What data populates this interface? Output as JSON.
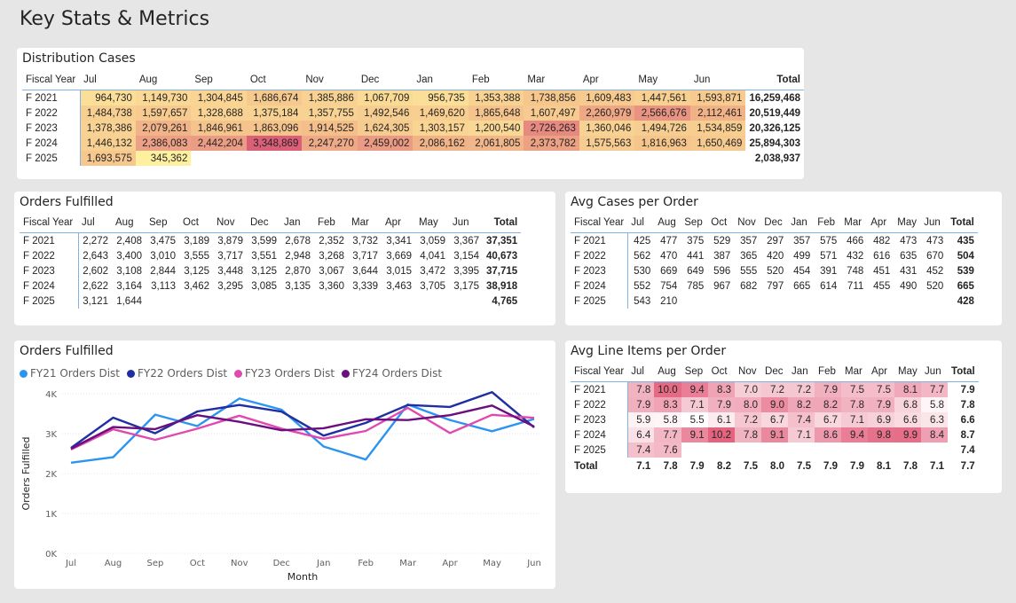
{
  "page": {
    "title": "Key Stats & Metrics"
  },
  "months": [
    "Jul",
    "Aug",
    "Sep",
    "Oct",
    "Nov",
    "Dec",
    "Jan",
    "Feb",
    "Mar",
    "Apr",
    "May",
    "Jun"
  ],
  "dist": {
    "title": "Distribution Cases",
    "fy_label": "Fiscal Year",
    "total_label": "Total",
    "rows": [
      {
        "fy": "F 2021",
        "vals": [
          "964,730",
          "1,149,730",
          "1,304,845",
          "1,686,674",
          "1,385,886",
          "1,067,709",
          "956,735",
          "1,353,388",
          "1,738,856",
          "1,609,483",
          "1,447,561",
          "1,593,871"
        ],
        "total": "16,259,468"
      },
      {
        "fy": "F 2022",
        "vals": [
          "1,484,738",
          "1,597,657",
          "1,328,688",
          "1,375,184",
          "1,357,755",
          "1,492,546",
          "1,469,620",
          "1,865,648",
          "1,607,497",
          "2,260,979",
          "2,566,676",
          "2,112,461"
        ],
        "total": "20,519,449"
      },
      {
        "fy": "F 2023",
        "vals": [
          "1,378,386",
          "2,079,261",
          "1,846,961",
          "1,863,096",
          "1,914,525",
          "1,624,305",
          "1,303,157",
          "1,200,540",
          "2,726,263",
          "1,360,046",
          "1,494,726",
          "1,534,859"
        ],
        "total": "20,326,125"
      },
      {
        "fy": "F 2024",
        "vals": [
          "1,446,132",
          "2,386,083",
          "2,442,204",
          "3,348,869",
          "2,247,270",
          "2,459,002",
          "2,086,162",
          "2,061,805",
          "2,373,782",
          "1,575,563",
          "1,816,963",
          "1,650,469"
        ],
        "total": "25,894,303"
      },
      {
        "fy": "F 2025",
        "vals": [
          "1,693,575",
          "345,362",
          "",
          "",
          "",
          "",
          "",
          "",
          "",
          "",
          "",
          ""
        ],
        "total": "2,038,937"
      }
    ]
  },
  "orders": {
    "title": "Orders Fulfilled",
    "fy_label": "Fiscal Year",
    "total_label": "Total",
    "rows": [
      {
        "fy": "F 2021",
        "vals": [
          "2,272",
          "2,408",
          "3,475",
          "3,189",
          "3,879",
          "3,599",
          "2,678",
          "2,352",
          "3,732",
          "3,341",
          "3,059",
          "3,367"
        ],
        "total": "37,351"
      },
      {
        "fy": "F 2022",
        "vals": [
          "2,643",
          "3,400",
          "3,010",
          "3,555",
          "3,717",
          "3,551",
          "2,948",
          "3,268",
          "3,717",
          "3,669",
          "4,041",
          "3,154"
        ],
        "total": "40,673"
      },
      {
        "fy": "F 2023",
        "vals": [
          "2,602",
          "3,108",
          "2,844",
          "3,125",
          "3,448",
          "3,125",
          "2,870",
          "3,067",
          "3,644",
          "3,015",
          "3,472",
          "3,395"
        ],
        "total": "37,715"
      },
      {
        "fy": "F 2024",
        "vals": [
          "2,622",
          "3,164",
          "3,113",
          "3,462",
          "3,295",
          "3,085",
          "3,135",
          "3,360",
          "3,339",
          "3,463",
          "3,705",
          "3,175"
        ],
        "total": "38,918"
      },
      {
        "fy": "F 2025",
        "vals": [
          "3,121",
          "1,644",
          "",
          "",
          "",
          "",
          "",
          "",
          "",
          "",
          "",
          ""
        ],
        "total": "4,765"
      }
    ]
  },
  "avgcases": {
    "title": "Avg Cases per Order",
    "fy_label": "Fiscal Year",
    "total_label": "Total",
    "rows": [
      {
        "fy": "F 2021",
        "vals": [
          "425",
          "477",
          "375",
          "529",
          "357",
          "297",
          "357",
          "575",
          "466",
          "482",
          "473",
          "473"
        ],
        "total": "435"
      },
      {
        "fy": "F 2022",
        "vals": [
          "562",
          "470",
          "441",
          "387",
          "365",
          "420",
          "499",
          "571",
          "432",
          "616",
          "635",
          "670"
        ],
        "total": "504"
      },
      {
        "fy": "F 2023",
        "vals": [
          "530",
          "669",
          "649",
          "596",
          "555",
          "520",
          "454",
          "391",
          "748",
          "451",
          "431",
          "452"
        ],
        "total": "539"
      },
      {
        "fy": "F 2024",
        "vals": [
          "552",
          "754",
          "785",
          "967",
          "682",
          "797",
          "665",
          "614",
          "711",
          "455",
          "490",
          "520"
        ],
        "total": "665"
      },
      {
        "fy": "F 2025",
        "vals": [
          "543",
          "210",
          "",
          "",
          "",
          "",
          "",
          "",
          "",
          "",
          "",
          ""
        ],
        "total": "428"
      }
    ]
  },
  "avglines": {
    "title": "Avg Line Items per Order",
    "fy_label": "Fiscal Year",
    "total_label": "Total",
    "rows": [
      {
        "fy": "F 2021",
        "vals": [
          "7.8",
          "10.0",
          "9.4",
          "8.3",
          "7.0",
          "7.2",
          "7.2",
          "7.9",
          "7.5",
          "7.5",
          "8.1",
          "7.7"
        ],
        "total": "7.9"
      },
      {
        "fy": "F 2022",
        "vals": [
          "7.9",
          "8.3",
          "7.1",
          "7.9",
          "8.0",
          "9.0",
          "8.2",
          "8.2",
          "7.8",
          "7.9",
          "6.8",
          "5.8"
        ],
        "total": "7.8"
      },
      {
        "fy": "F 2023",
        "vals": [
          "5.9",
          "5.8",
          "5.5",
          "6.1",
          "7.2",
          "6.7",
          "7.4",
          "6.7",
          "7.1",
          "6.9",
          "6.6",
          "6.3"
        ],
        "total": "6.6"
      },
      {
        "fy": "F 2024",
        "vals": [
          "6.4",
          "7.7",
          "9.1",
          "10.2",
          "7.8",
          "9.1",
          "7.1",
          "8.6",
          "9.4",
          "9.8",
          "9.9",
          "8.4"
        ],
        "total": "8.7"
      },
      {
        "fy": "F 2025",
        "vals": [
          "7.4",
          "7.6",
          "",
          "",
          "",
          "",
          "",
          "",
          "",
          "",
          "",
          ""
        ],
        "total": "7.4"
      }
    ],
    "total_row": {
      "label": "Total",
      "vals": [
        "7.1",
        "7.8",
        "7.9",
        "8.2",
        "7.5",
        "8.0",
        "7.5",
        "7.9",
        "7.9",
        "8.1",
        "7.8",
        "7.1"
      ],
      "total": "7.7"
    }
  },
  "chart_data": {
    "type": "line",
    "title": "Orders Fulfilled",
    "xlabel": "Month",
    "ylabel": "Orders Fulfilled",
    "x": [
      "Jul",
      "Aug",
      "Sep",
      "Oct",
      "Nov",
      "Dec",
      "Jan",
      "Feb",
      "Mar",
      "Apr",
      "May",
      "Jun"
    ],
    "yticks": [
      "0K",
      "1K",
      "2K",
      "3K",
      "4K"
    ],
    "ylim": [
      0,
      4300
    ],
    "legend_position": "top-left",
    "series": [
      {
        "name": "FY21 Orders Dist",
        "color": "#2b94f0",
        "values": [
          2272,
          2408,
          3475,
          3189,
          3879,
          3599,
          2678,
          2352,
          3732,
          3341,
          3059,
          3367
        ]
      },
      {
        "name": "FY22 Orders Dist",
        "color": "#1f2fa3",
        "values": [
          2643,
          3400,
          3010,
          3555,
          3717,
          3551,
          2948,
          3268,
          3717,
          3669,
          4041,
          3154
        ]
      },
      {
        "name": "FY23 Orders Dist",
        "color": "#e04aaf",
        "values": [
          2602,
          3108,
          2844,
          3125,
          3448,
          3125,
          2870,
          3067,
          3644,
          3015,
          3472,
          3395
        ]
      },
      {
        "name": "FY24 Orders Dist",
        "color": "#6b0f7f",
        "values": [
          2622,
          3164,
          3113,
          3462,
          3295,
          3085,
          3135,
          3360,
          3339,
          3463,
          3705,
          3175
        ]
      }
    ]
  }
}
